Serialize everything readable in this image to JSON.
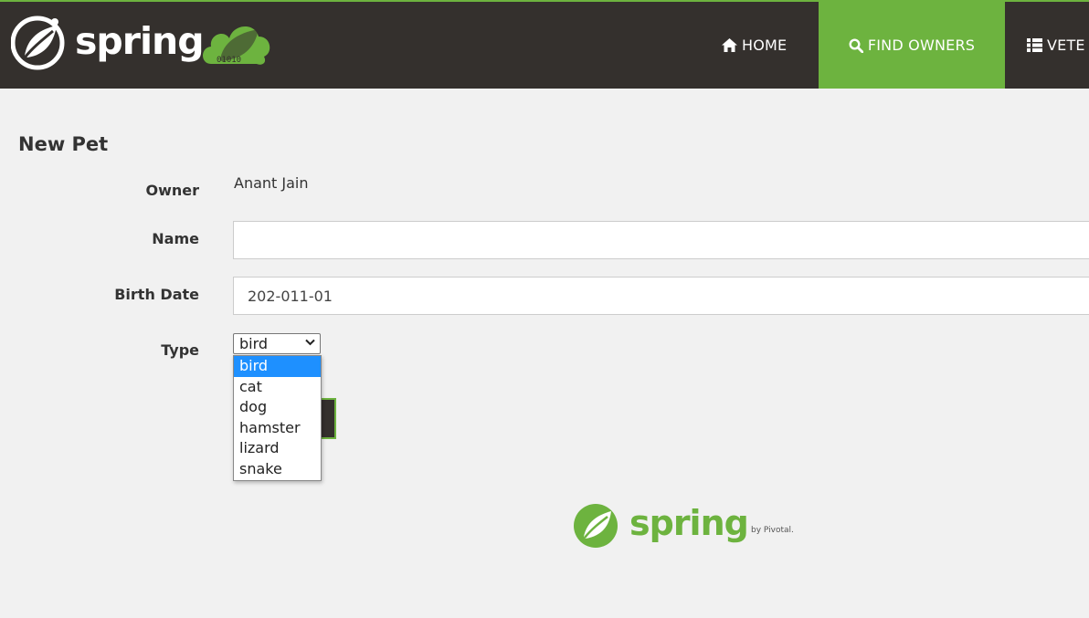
{
  "brand": {
    "name": "spring",
    "badge_digits": "01010"
  },
  "nav": {
    "home": "HOME",
    "find_owners": "FIND OWNERS",
    "veterinarians": "VETE"
  },
  "form": {
    "title": "New Pet",
    "owner_label": "Owner",
    "owner_value": "Anant Jain",
    "name_label": "Name",
    "name_value": "",
    "birth_label": "Birth Date",
    "birth_value": "202-011-01",
    "type_label": "Type",
    "type_selected": "bird",
    "type_options": [
      "bird",
      "cat",
      "dog",
      "hamster",
      "lizard",
      "snake"
    ]
  },
  "footer": {
    "name": "spring",
    "by": "by Pivotal."
  },
  "colors": {
    "nav_bg": "#34302d",
    "accent": "#6db33f",
    "page_bg": "#f1f1f1",
    "selected_option": "#1e90ff"
  }
}
